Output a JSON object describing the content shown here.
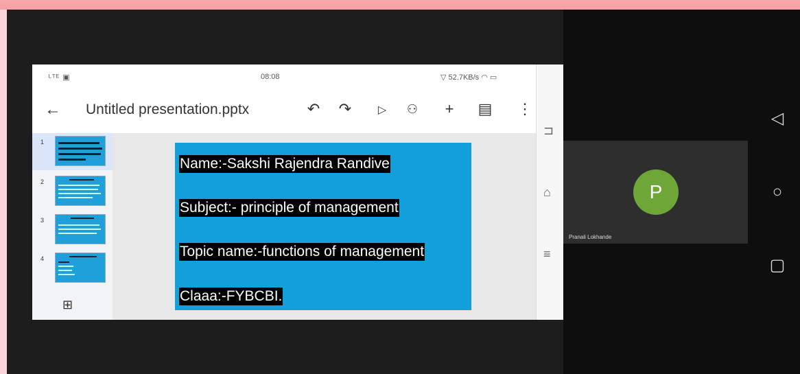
{
  "status_bar": {
    "left": "ᴸᵀᴱ ▣",
    "time": "08:08",
    "right": "52.7KB/s"
  },
  "app_bar": {
    "title": "Untitled presentation.pptx"
  },
  "thumbnails": [
    {
      "number": "1",
      "selected": true
    },
    {
      "number": "2",
      "selected": false
    },
    {
      "number": "3",
      "selected": false
    },
    {
      "number": "4",
      "selected": false
    }
  ],
  "slide": {
    "background": "#129fdc",
    "lines": [
      "Name:-Sakshi Rajendra Randive",
      "Subject:- principle of management",
      "Topic name:-functions of management",
      "Claaa:-FYBCBI."
    ]
  },
  "participant": {
    "initial": "P",
    "name": "Pranali Lokhande",
    "avatar_color": "#6ea638"
  },
  "icons": {
    "back": "arrow-left-icon",
    "undo": "undo-icon",
    "redo": "redo-icon",
    "play": "play-icon",
    "share": "add-person-icon",
    "insert": "plus-icon",
    "comments": "comment-icon",
    "more": "more-vertical-icon",
    "new_slide": "new-slide-icon",
    "recents": "recents-icon",
    "home": "home-icon",
    "menu": "menu-icon",
    "sys_back": "triangle-back-icon",
    "sys_home": "circle-home-icon",
    "sys_recents": "square-recents-icon"
  }
}
